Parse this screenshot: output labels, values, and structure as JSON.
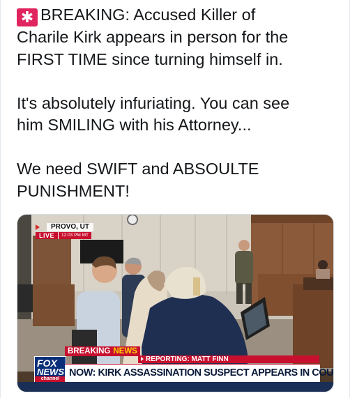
{
  "tweet": {
    "lines": {
      "l1": "BREAKING: Accused Killer of",
      "l2": "Charile Kirk appears in person for the",
      "l3": "FIRST TIME since turning himself in.",
      "l4": "It's absolutely infuriating. You can see",
      "l5": "him SMILING with his Attorney...",
      "l6": "We need SWIFT and ABSOULTE",
      "l7": "PUNISHMENT!"
    },
    "emoji": "siren-icon"
  },
  "video": {
    "location": "PROVO, UT",
    "live_label": "LIVE",
    "live_time": "12:03 PM MT",
    "breaking_label": "BREAKING",
    "news_label": "NEWS",
    "reporting": "REPORTING: MATT FINN",
    "headline": "NOW: KIRK ASSASSINATION SUSPECT APPEARS IN COURT",
    "logo": {
      "fox": "FOX",
      "news": "NEWS",
      "channel": "channel"
    }
  },
  "colors": {
    "fox_red": "#c8102e",
    "fox_navy": "#0a2f7a",
    "siren": "#e0245e"
  }
}
